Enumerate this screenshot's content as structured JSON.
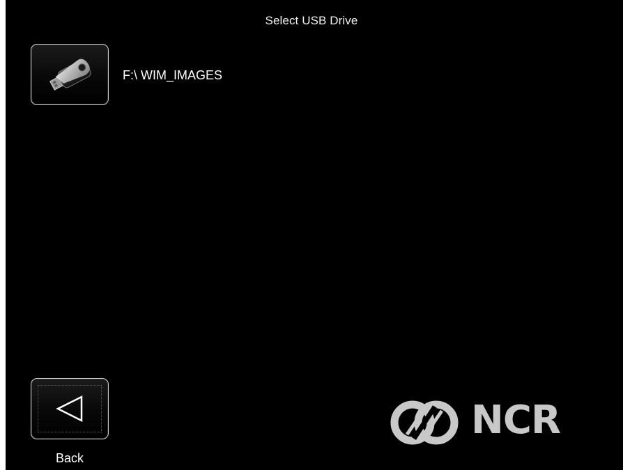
{
  "header": {
    "title": "Select USB Drive"
  },
  "drives": [
    {
      "label": "F:\\ WIM_IMAGES",
      "icon": "usb-drive-icon"
    }
  ],
  "navigation": {
    "back_label": "Back",
    "back_icon": "back-arrow-icon"
  },
  "branding": {
    "logo_text": "NCR",
    "logo_icon": "ncr-logo-icon"
  },
  "colors": {
    "background": "#000000",
    "text": "#ffffff",
    "tile_border": "#cfcfcf",
    "logo": "#c8c8c8"
  }
}
